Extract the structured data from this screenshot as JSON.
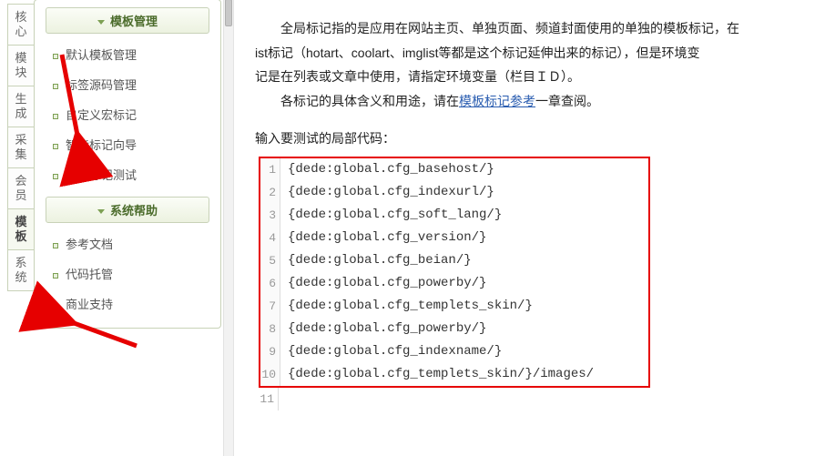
{
  "tabs": {
    "t0": "核心",
    "t1": "模块",
    "t2": "生成",
    "t3": "采集",
    "t4": "会员",
    "t5": "模板",
    "t6": "系统"
  },
  "sidebar": {
    "group1": "模板管理",
    "item1": "默认模板管理",
    "item2": "标签源码管理",
    "item3": "自定义宏标记",
    "item4": "智能标记向导",
    "item5": "全局标记测试",
    "group2": "系统帮助",
    "item6": "参考文档",
    "item7": "代码托管",
    "item8": "商业支持"
  },
  "desc": {
    "p1a": "全局标记指的是应用在网站主页、单独页面、频道封面使用的单独的模板标记，在",
    "p1b": "ist标记（hotart、coolart、imglist等都是这个标记延伸出来的标记），但是环境变",
    "p1c": "记是在列表或文章中使用，请指定环境变量（栏目ＩＤ）。",
    "p2a": "各标记的具体含义和用途，请在",
    "p2link": "模板标记参考",
    "p2b": "一章查阅。"
  },
  "label": "输入要测试的局部代码：",
  "code": {
    "l1": "{dede:global.cfg_basehost/}",
    "l2": "{dede:global.cfg_indexurl/}",
    "l3": "{dede:global.cfg_soft_lang/}",
    "l4": "{dede:global.cfg_version/}",
    "l5": "{dede:global.cfg_beian/}",
    "l6": "{dede:global.cfg_powerby/}",
    "l7": "{dede:global.cfg_templets_skin/}",
    "l8": "{dede:global.cfg_powerby/}",
    "l9": "{dede:global.cfg_indexname/}",
    "l10": "{dede:global.cfg_templets_skin/}/images/"
  }
}
